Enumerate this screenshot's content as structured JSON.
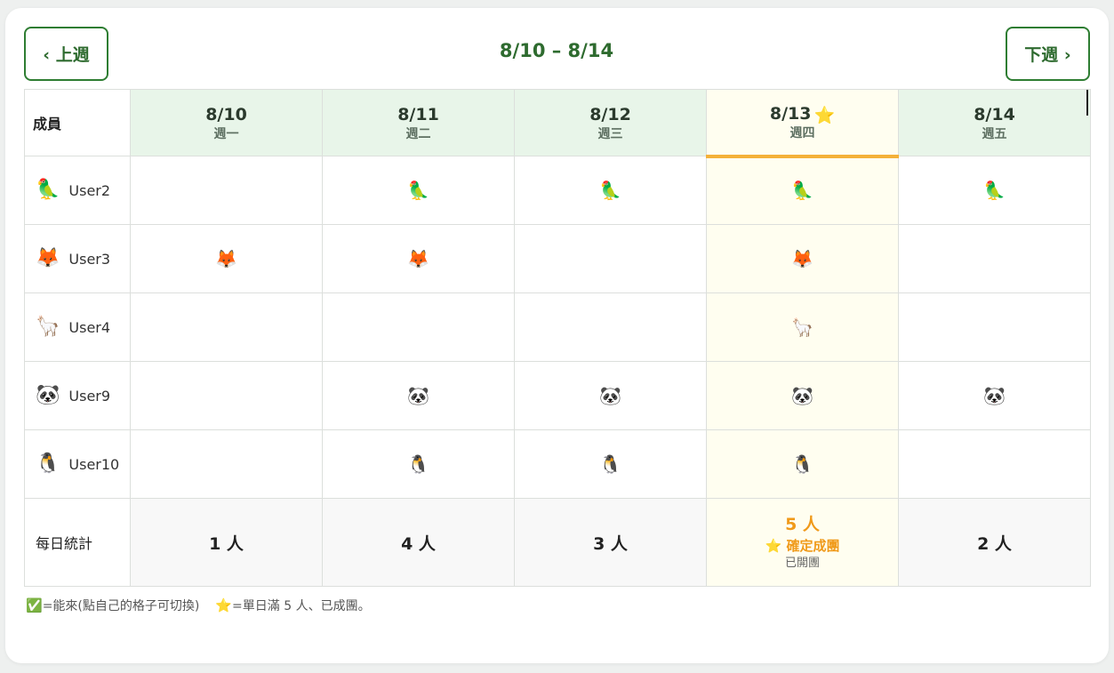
{
  "nav": {
    "prev_label": "‹ 上週",
    "next_label": "下週 ›",
    "week_range": "8/10 – 8/14"
  },
  "table": {
    "member_header": "成員",
    "days": [
      {
        "date": "8/10",
        "weekday": "週一",
        "star": ""
      },
      {
        "date": "8/11",
        "weekday": "週二",
        "star": ""
      },
      {
        "date": "8/12",
        "weekday": "週三",
        "star": ""
      },
      {
        "date": "8/13",
        "weekday": "週四",
        "star": "⭐"
      },
      {
        "date": "8/14",
        "weekday": "週五",
        "star": ""
      }
    ],
    "members": [
      {
        "name": "User2",
        "avatar": "🦜",
        "avail": [
          "",
          "🦜",
          "🦜",
          "🦜",
          "🦜"
        ]
      },
      {
        "name": "User3",
        "avatar": "🦊",
        "avail": [
          "🦊",
          "🦊",
          "",
          "🦊",
          ""
        ]
      },
      {
        "name": "User4",
        "avatar": "🦙",
        "avail": [
          "",
          "",
          "",
          "🦙",
          ""
        ]
      },
      {
        "name": "User9",
        "avatar": "🐼",
        "avail": [
          "",
          "🐼",
          "🐼",
          "🐼",
          "🐼"
        ]
      },
      {
        "name": "User10",
        "avatar": "🐧",
        "avail": [
          "",
          "🐧",
          "🐧",
          "🐧",
          ""
        ]
      }
    ],
    "stats_label": "每日統計",
    "stats": [
      "1 人",
      "4 人",
      "3 人",
      "5 人",
      "2 人"
    ],
    "today_confirmed": "⭐ 確定成團",
    "today_opened": "已開團"
  },
  "legend": {
    "check_icon": "✅",
    "check_text": "=能來(點自己的格子可切換)",
    "star_icon": "⭐",
    "star_text": "=單日滿 5 人、已成團。"
  },
  "colors": {
    "accent": "#2e7d32",
    "highlight": "#f09a1a",
    "today_bg": "#fffef0",
    "header_bg": "#e8f5e9"
  }
}
